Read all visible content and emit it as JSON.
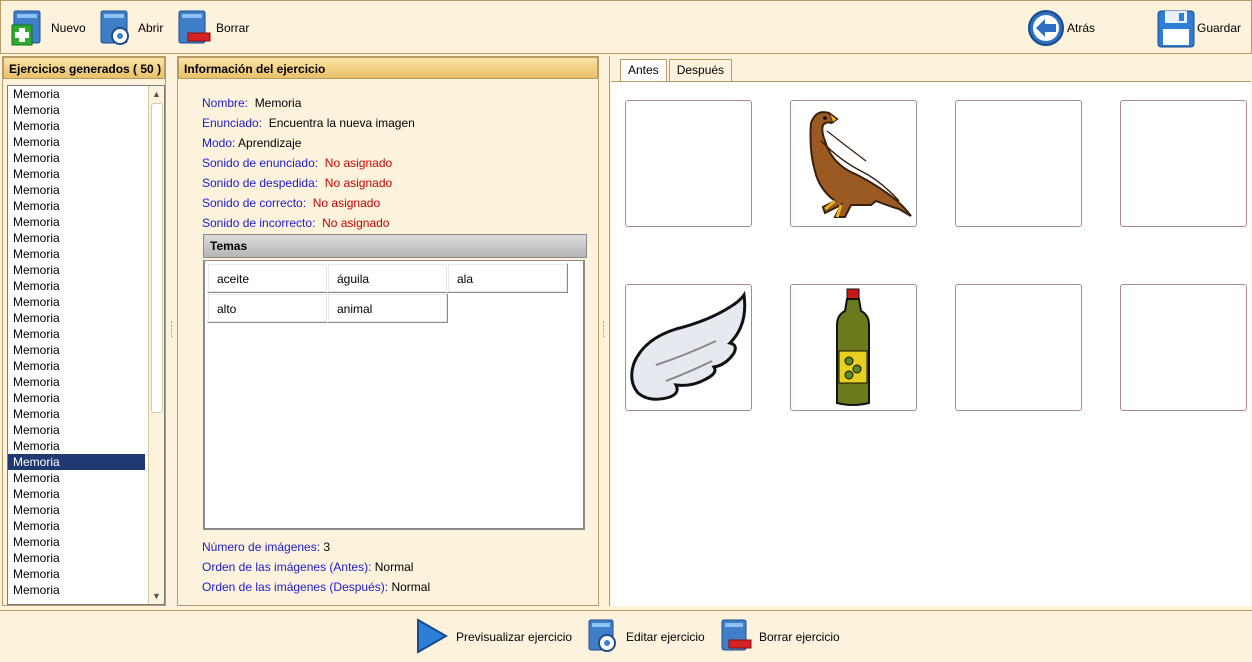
{
  "toolbar": {
    "nuevo": "Nuevo",
    "abrir": "Abrir",
    "borrar": "Borrar",
    "atras": "Atrás",
    "guardar": "Guardar"
  },
  "left_panel": {
    "title": "Ejercicios generados ( 50 )",
    "items": [
      "Memoria",
      "Memoria",
      "Memoria",
      "Memoria",
      "Memoria",
      "Memoria",
      "Memoria",
      "Memoria",
      "Memoria",
      "Memoria",
      "Memoria",
      "Memoria",
      "Memoria",
      "Memoria",
      "Memoria",
      "Memoria",
      "Memoria",
      "Memoria",
      "Memoria",
      "Memoria",
      "Memoria",
      "Memoria",
      "Memoria",
      "Memoria",
      "Memoria",
      "Memoria",
      "Memoria",
      "Memoria",
      "Memoria",
      "Memoria",
      "Memoria",
      "Memoria"
    ],
    "selected_index": 23
  },
  "info_panel": {
    "title": "Información del ejercicio",
    "nombre_label": "Nombre:",
    "nombre_value": "Memoria",
    "enunciado_label": "Enunciado:",
    "enunciado_value": "Encuentra la nueva imagen",
    "modo_label": "Modo:",
    "modo_value": "Aprendizaje",
    "sonido_enunciado_label": "Sonido de enunciado:",
    "sonido_enunciado_value": "No asignado",
    "sonido_despedida_label": "Sonido de despedida:",
    "sonido_despedida_value": "No asignado",
    "sonido_correcto_label": "Sonido de correcto:",
    "sonido_correcto_value": "No asignado",
    "sonido_incorrecto_label": "Sonido de incorrecto:",
    "sonido_incorrecto_value": "No asignado",
    "temas_title": "Temas",
    "temas": [
      "aceite",
      "águila",
      "ala",
      "alto",
      "animal"
    ],
    "num_imagenes_label": "Número de imágenes:",
    "num_imagenes_value": "3",
    "orden_antes_label": "Orden de las imágenes (Antes):",
    "orden_antes_value": "Normal",
    "orden_despues_label": "Orden de las imágenes (Después):",
    "orden_despues_value": "Normal"
  },
  "right_panel": {
    "tabs": [
      "Antes",
      "Después"
    ],
    "active_tab": 0,
    "cards": [
      "empty",
      "eagle-image",
      "empty",
      "empty",
      "wing-image",
      "oil-bottle-image",
      "empty",
      "empty"
    ]
  },
  "bottombar": {
    "previsualizar": "Previsualizar ejercicio",
    "editar": "Editar ejercicio",
    "borrar": "Borrar ejercicio"
  },
  "colors": {
    "background": "#fdf3dc",
    "header_gradient_top": "#fbe3a6",
    "header_gradient_bottom": "#e8c169",
    "selection": "#1f3a73",
    "key_text": "#1a1ad6",
    "warn_text": "#d10000"
  }
}
